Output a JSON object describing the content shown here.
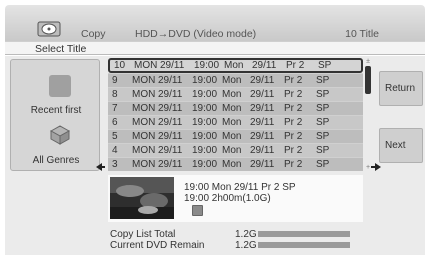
{
  "header": {
    "mode": "Copy",
    "path": "HDD→DVD (Video mode)",
    "count": "10 Title",
    "disc_icon": "disc-copy-icon"
  },
  "subheader": {
    "title": "Select Title"
  },
  "left_panel": {
    "sort_label": "Recent first",
    "sort_icon": "square-icon",
    "genre_label": "All Genres",
    "genre_icon": "genre-box-icon"
  },
  "list": {
    "rows": [
      {
        "num": "10",
        "day": "MON",
        "date": "29/11",
        "time": "19:00",
        "day2": "Mon",
        "date2": "29/11",
        "pr": "Pr 2",
        "mode": "SP"
      },
      {
        "num": "9",
        "day": "MON",
        "date": "29/11",
        "time": "19:00",
        "day2": "Mon",
        "date2": "29/11",
        "pr": "Pr 2",
        "mode": "SP"
      },
      {
        "num": "8",
        "day": "MON",
        "date": "29/11",
        "time": "19:00",
        "day2": "Mon",
        "date2": "29/11",
        "pr": "Pr 2",
        "mode": "SP"
      },
      {
        "num": "7",
        "day": "MON",
        "date": "29/11",
        "time": "19:00",
        "day2": "Mon",
        "date2": "29/11",
        "pr": "Pr 2",
        "mode": "SP"
      },
      {
        "num": "6",
        "day": "MON",
        "date": "29/11",
        "time": "19:00",
        "day2": "Mon",
        "date2": "29/11",
        "pr": "Pr 2",
        "mode": "SP"
      },
      {
        "num": "5",
        "day": "MON",
        "date": "29/11",
        "time": "19:00",
        "day2": "Mon",
        "date2": "29/11",
        "pr": "Pr 2",
        "mode": "SP"
      },
      {
        "num": "4",
        "day": "MON",
        "date": "29/11",
        "time": "19:00",
        "day2": "Mon",
        "date2": "29/11",
        "pr": "Pr 2",
        "mode": "SP"
      },
      {
        "num": "3",
        "day": "MON",
        "date": "29/11",
        "time": "19:00",
        "day2": "Mon",
        "date2": "29/11",
        "pr": "Pr 2",
        "mode": "SP"
      }
    ],
    "selected_index": 0
  },
  "buttons": {
    "return_label": "Return",
    "next_label": "Next"
  },
  "preview": {
    "line1": "19:00 Mon  29/11   Pr 2   SP",
    "line2": "19:00          2h00m(1.0G)",
    "edit_icon": "edit-icon"
  },
  "info": {
    "total_label": "Copy List Total",
    "total_value": "1.2G",
    "remain_label": "Current DVD Remain",
    "remain_value": "1.2G"
  },
  "icons": {
    "arrow_left": "arrow-left-icon",
    "arrow_right": "arrow-right-icon"
  }
}
